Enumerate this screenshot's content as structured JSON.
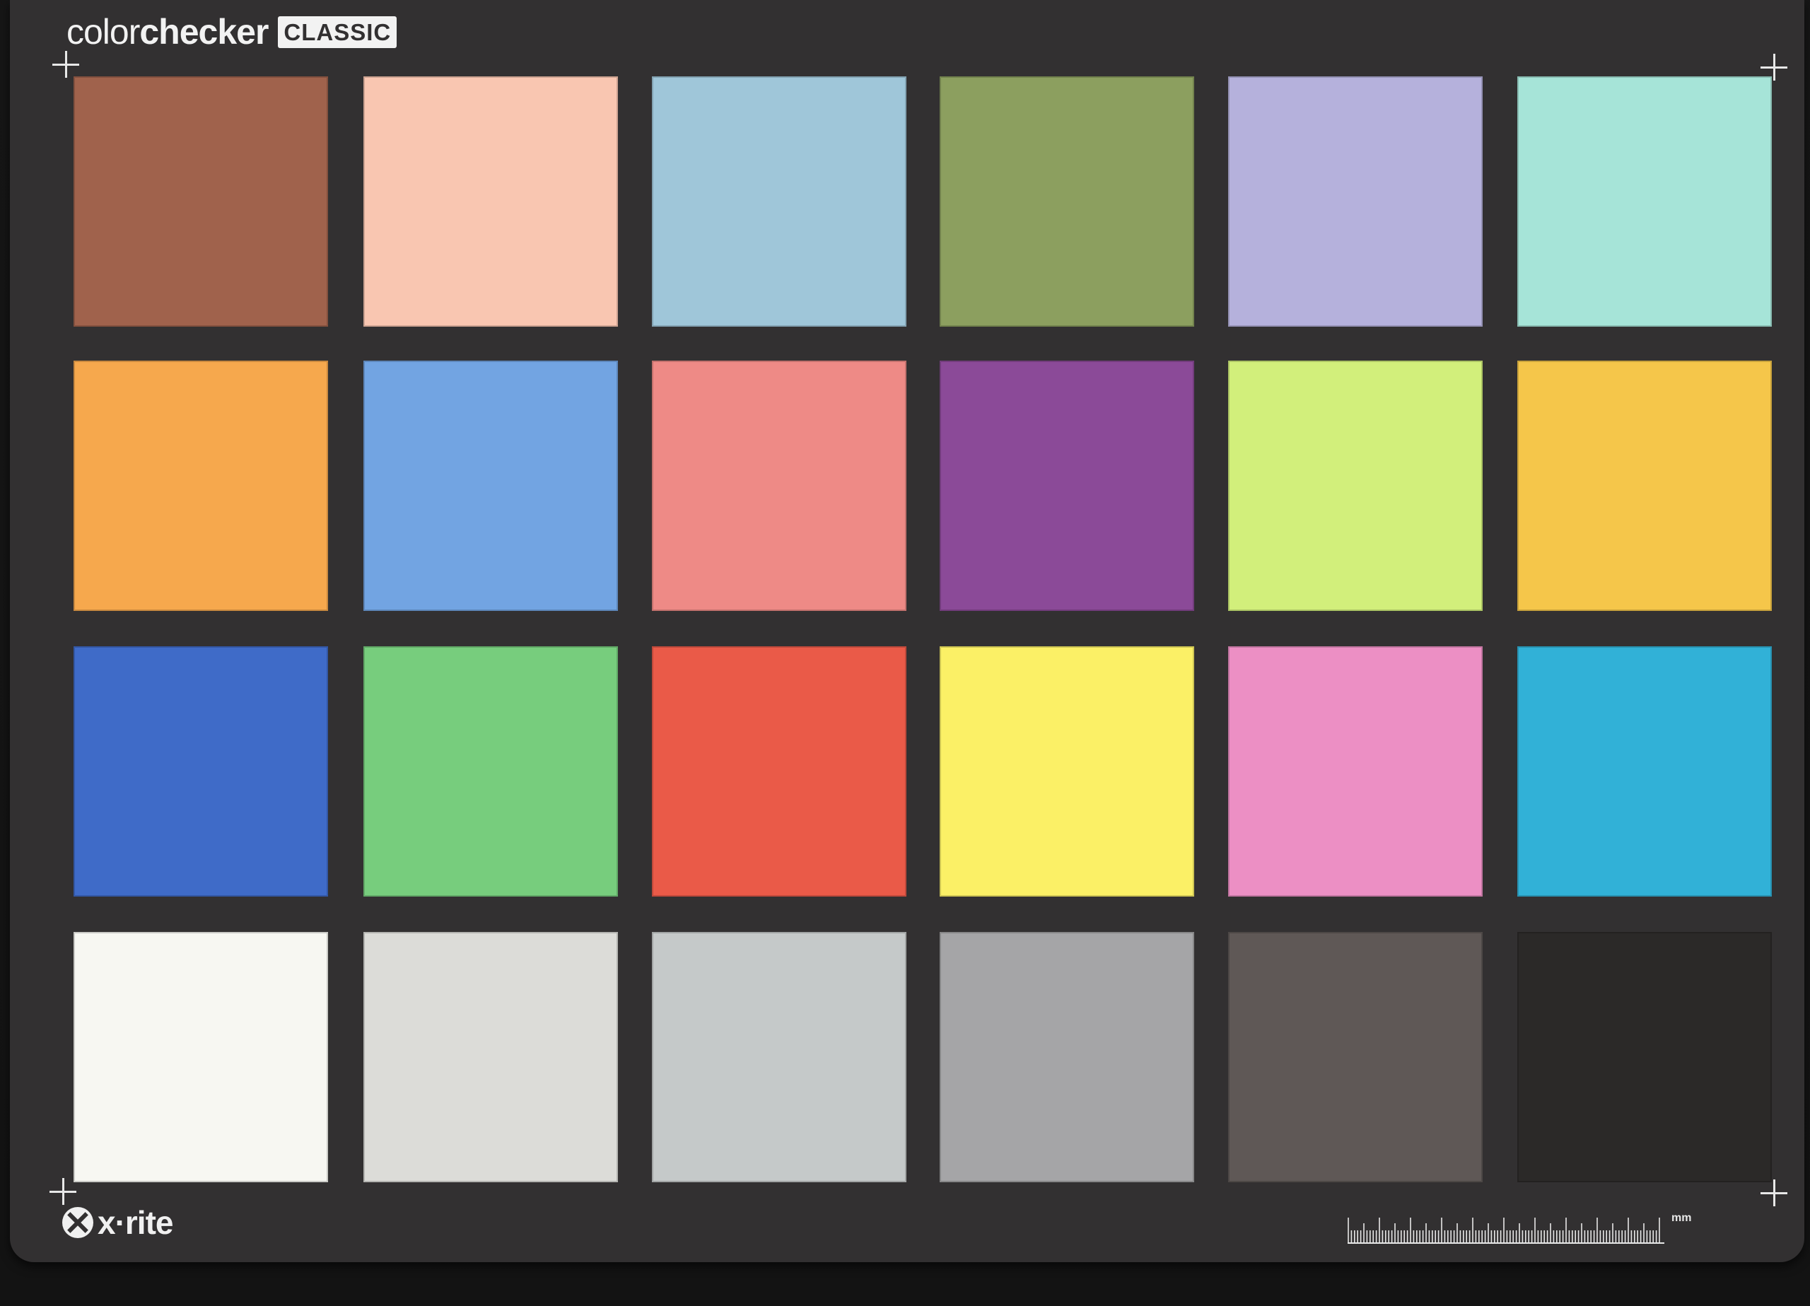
{
  "card": {
    "brand_light": "color",
    "brand_bold": "checker",
    "brand_badge": "CLASSIC",
    "logo_text": "x·rite",
    "ruler_unit": "mm",
    "icons": [
      "crosshair-icon",
      "xrite-logo-icon",
      "ruler-icon"
    ]
  },
  "patches": [
    {
      "row": 1,
      "col": 1,
      "color": "#a0624c"
    },
    {
      "row": 1,
      "col": 2,
      "color": "#f9c6b1"
    },
    {
      "row": 1,
      "col": 3,
      "color": "#9fc6d9"
    },
    {
      "row": 1,
      "col": 4,
      "color": "#8c9f5f"
    },
    {
      "row": 1,
      "col": 5,
      "color": "#b5b1dc"
    },
    {
      "row": 1,
      "col": 6,
      "color": "#a6e4d8"
    },
    {
      "row": 2,
      "col": 1,
      "color": "#f6a84d"
    },
    {
      "row": 2,
      "col": 2,
      "color": "#72a4e2"
    },
    {
      "row": 2,
      "col": 3,
      "color": "#ee8a86"
    },
    {
      "row": 2,
      "col": 4,
      "color": "#8b4a98"
    },
    {
      "row": 2,
      "col": 5,
      "color": "#d2ef7b"
    },
    {
      "row": 2,
      "col": 6,
      "color": "#f5c64a"
    },
    {
      "row": 3,
      "col": 1,
      "color": "#3f6bc8"
    },
    {
      "row": 3,
      "col": 2,
      "color": "#77cd7d"
    },
    {
      "row": 3,
      "col": 3,
      "color": "#ea5a48"
    },
    {
      "row": 3,
      "col": 4,
      "color": "#fbf066"
    },
    {
      "row": 3,
      "col": 5,
      "color": "#ec8fc4"
    },
    {
      "row": 3,
      "col": 6,
      "color": "#31b1d7"
    },
    {
      "row": 4,
      "col": 1,
      "color": "#f7f7f2"
    },
    {
      "row": 4,
      "col": 2,
      "color": "#dcdcd8"
    },
    {
      "row": 4,
      "col": 3,
      "color": "#c5c9c9"
    },
    {
      "row": 4,
      "col": 4,
      "color": "#a5a5a7"
    },
    {
      "row": 4,
      "col": 5,
      "color": "#5f5856"
    },
    {
      "row": 4,
      "col": 6,
      "color": "#2b2928"
    }
  ]
}
